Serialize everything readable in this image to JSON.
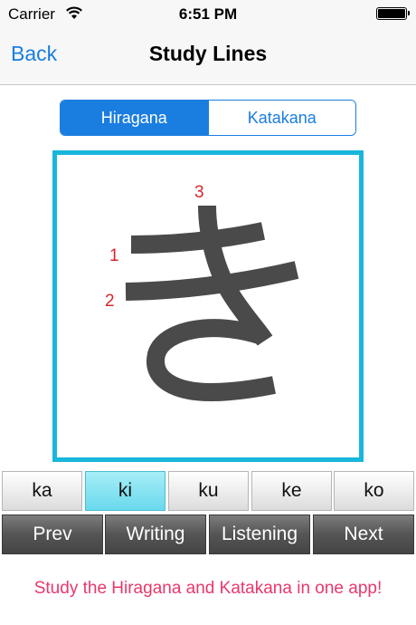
{
  "status_bar": {
    "carrier": "Carrier",
    "time": "6:51 PM"
  },
  "nav": {
    "back_label": "Back",
    "title": "Study Lines"
  },
  "segments": [
    "Hiragana",
    "Katakana"
  ],
  "selected_segment": "Hiragana",
  "character": {
    "glyph": "き",
    "stroke_numbers": [
      "1",
      "2",
      "3"
    ]
  },
  "syllables": [
    "ka",
    "ki",
    "ku",
    "ke",
    "ko"
  ],
  "selected_syllable": "ki",
  "actions": {
    "prev": "Prev",
    "writing": "Writing",
    "listening": "Listening",
    "next": "Next"
  },
  "promo_text": "Study the Hiragana and Katakana in one app!",
  "colors": {
    "accent": "#1a7de0",
    "frame": "#19b6dc",
    "stroke_number": "#d9262b",
    "promo": "#e8386b",
    "glyph": "#4a4a4a"
  }
}
